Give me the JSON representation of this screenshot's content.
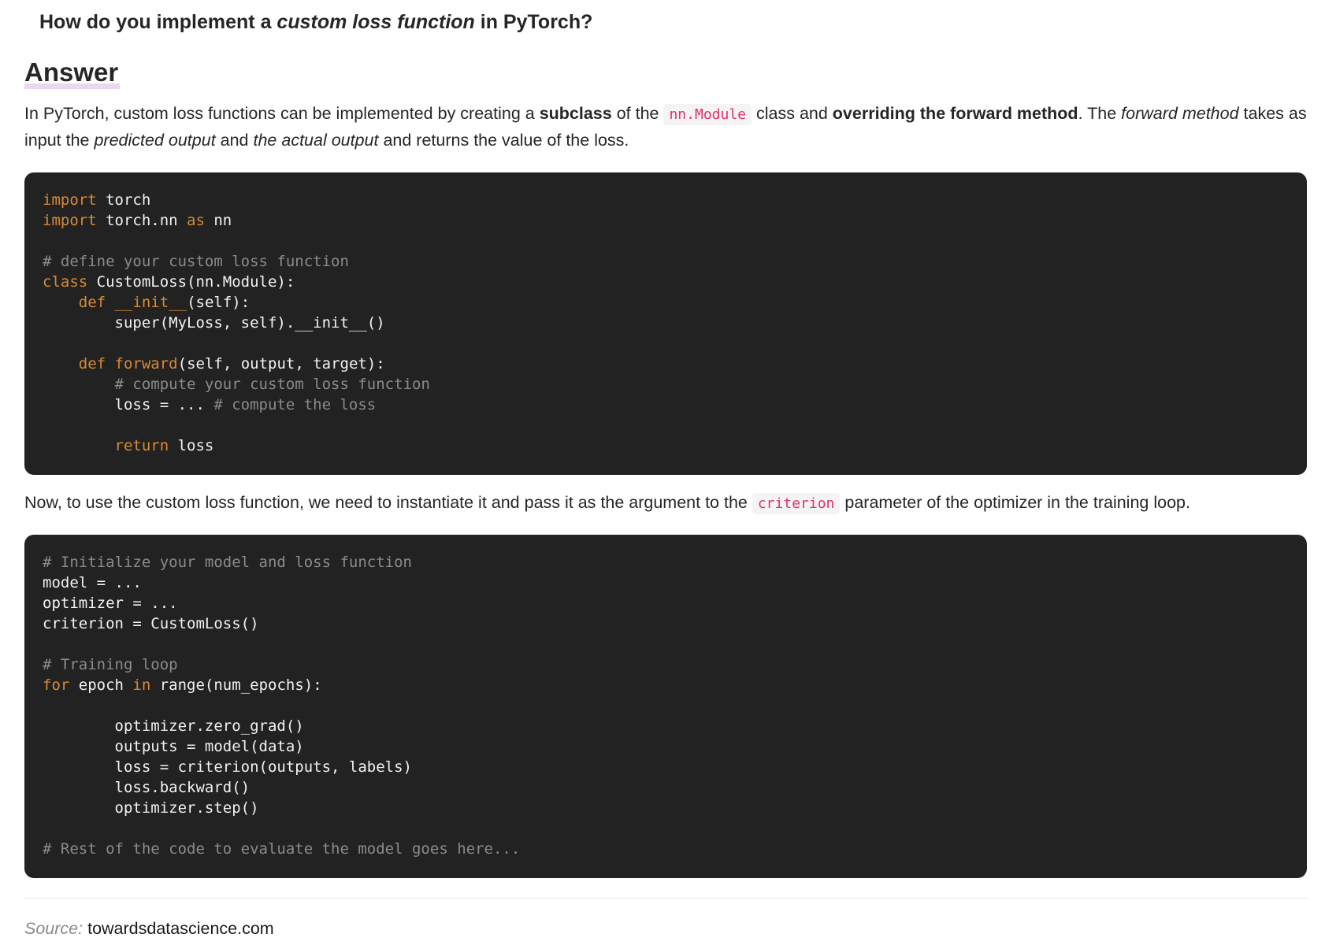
{
  "question": {
    "pre": "How do you implement a ",
    "em": "custom loss function",
    "post": " in PyTorch?"
  },
  "answer_heading": "Answer",
  "paragraph1": {
    "t1": "In PyTorch, custom loss functions can be implemented by creating a ",
    "b1": "subclass",
    "t2": " of the ",
    "code1": "nn.Module",
    "t3": " class and ",
    "b2": "overriding the forward method",
    "t4": ". The ",
    "i1": "forward method",
    "t5": " takes as input the ",
    "i2": "predicted output",
    "t6": " and ",
    "i3": "the actual output",
    "t7": " and returns the value of the loss."
  },
  "code_block_1": [
    [
      [
        "kw",
        "import"
      ],
      [
        "tx",
        " torch"
      ]
    ],
    [
      [
        "kw",
        "import"
      ],
      [
        "tx",
        " torch.nn "
      ],
      [
        "kw",
        "as"
      ],
      [
        "tx",
        " nn"
      ]
    ],
    [],
    [
      [
        "cm",
        "# define your custom loss function"
      ]
    ],
    [
      [
        "kw",
        "class"
      ],
      [
        "tx",
        " CustomLoss(nn.Module):"
      ]
    ],
    [
      [
        "tx",
        "    "
      ],
      [
        "kw",
        "def"
      ],
      [
        "tx",
        " "
      ],
      [
        "kw",
        "__init__"
      ],
      [
        "tx",
        "(self):"
      ]
    ],
    [
      [
        "tx",
        "        super(MyLoss, self).__init__()"
      ]
    ],
    [],
    [
      [
        "tx",
        "    "
      ],
      [
        "kw",
        "def"
      ],
      [
        "tx",
        " "
      ],
      [
        "kw",
        "forward"
      ],
      [
        "tx",
        "(self, output, target):"
      ]
    ],
    [
      [
        "tx",
        "        "
      ],
      [
        "cm",
        "# compute your custom loss function"
      ]
    ],
    [
      [
        "tx",
        "        loss = ... "
      ],
      [
        "cm",
        "# compute the loss"
      ]
    ],
    [],
    [
      [
        "tx",
        "        "
      ],
      [
        "kw",
        "return"
      ],
      [
        "tx",
        " loss"
      ]
    ]
  ],
  "paragraph2": {
    "t1": "Now, to use the custom loss function, we need to instantiate it and pass it as the argument to the ",
    "code1": "criterion",
    "t2": " parameter of the optimizer in the training loop."
  },
  "code_block_2": [
    [
      [
        "cm",
        "# Initialize your model and loss function"
      ]
    ],
    [
      [
        "tx",
        "model = ..."
      ]
    ],
    [
      [
        "tx",
        "optimizer = ..."
      ]
    ],
    [
      [
        "tx",
        "criterion = CustomLoss()"
      ]
    ],
    [],
    [
      [
        "cm",
        "# Training loop"
      ]
    ],
    [
      [
        "kw",
        "for"
      ],
      [
        "tx",
        " epoch "
      ],
      [
        "kw",
        "in"
      ],
      [
        "tx",
        " range(num_epochs):"
      ]
    ],
    [],
    [
      [
        "tx",
        "        optimizer.zero_grad()"
      ]
    ],
    [
      [
        "tx",
        "        outputs = model(data)"
      ]
    ],
    [
      [
        "tx",
        "        loss = criterion(outputs, labels)"
      ]
    ],
    [
      [
        "tx",
        "        loss.backward()"
      ]
    ],
    [
      [
        "tx",
        "        optimizer.step()"
      ]
    ],
    [],
    [
      [
        "cm",
        "# Rest of the code to evaluate the model goes here..."
      ]
    ]
  ],
  "source": {
    "label": "Source:",
    "link": "towardsdatascience.com"
  }
}
